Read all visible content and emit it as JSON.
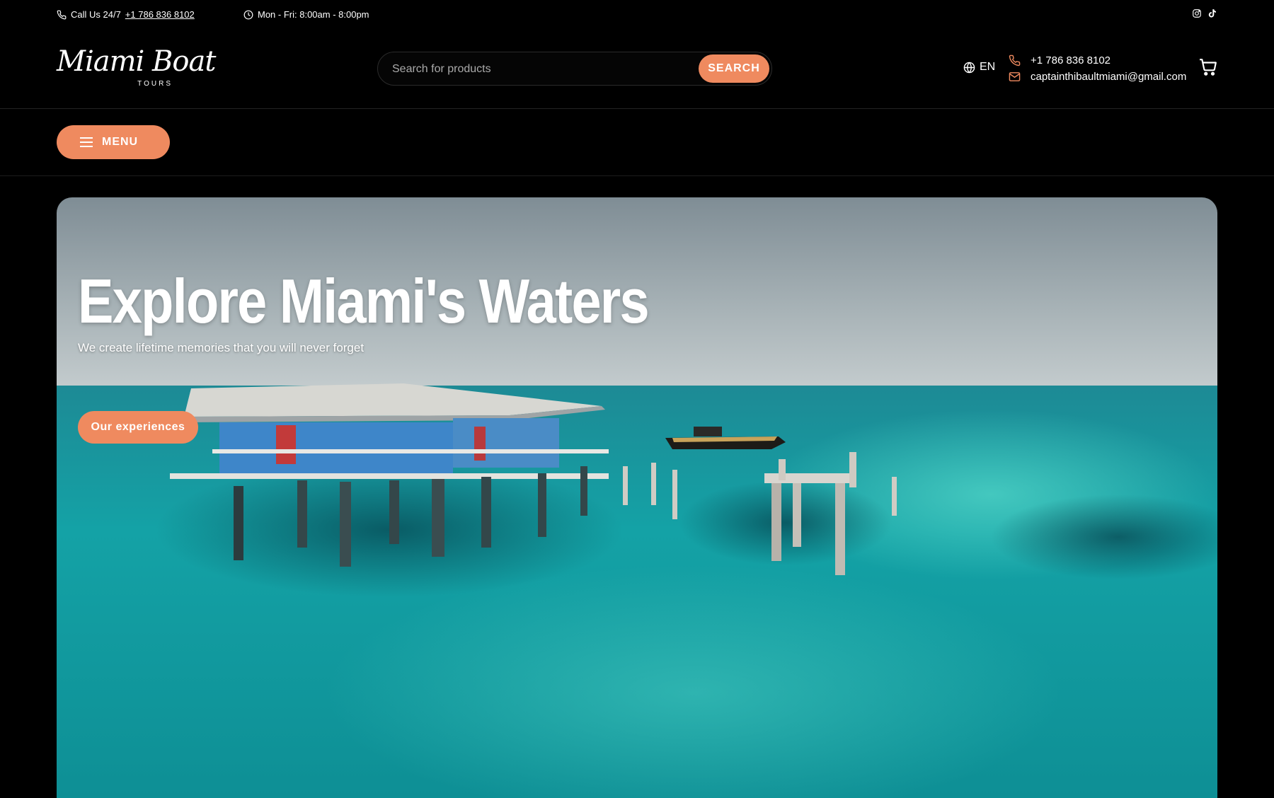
{
  "topbar": {
    "call_prefix": "Call Us 24/7",
    "call_phone": "+1 786 836 8102",
    "hours": "Mon - Fri: 8:00am - 8:00pm",
    "social": [
      "instagram-icon",
      "tiktok-icon"
    ]
  },
  "header": {
    "logo_script": "Miami Boat",
    "logo_sub": "TOURS",
    "search_placeholder": "Search for products",
    "search_button": "SEARCH",
    "language": "EN",
    "phone": "+1 786 836 8102",
    "email": "captainthibaultmiami@gmail.com"
  },
  "nav": {
    "menu_label": "MENU"
  },
  "hero": {
    "title": "Explore Miami's Waters",
    "subtitle": "We create lifetime memories that you will never forget",
    "cta": "Our experiences"
  },
  "colors": {
    "accent": "#ef8a5f",
    "background": "#000000"
  }
}
